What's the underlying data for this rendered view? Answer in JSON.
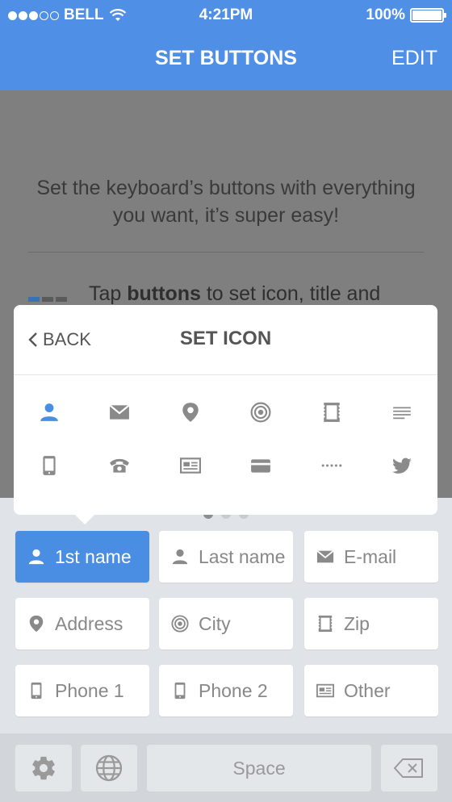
{
  "status": {
    "carrier": "BELL",
    "time": "4:21PM",
    "battery": "100%"
  },
  "nav": {
    "title": "SET BUTTONS",
    "edit": "EDIT"
  },
  "intro": "Set the keyboard’s buttons with everything you want, it’s super easy!",
  "tap": {
    "prefix": "Tap ",
    "bold": "buttons",
    "suffix": " to set icon, title and"
  },
  "popover": {
    "back": "BACK",
    "title": "SET ICON",
    "icons_row1": [
      "person-icon",
      "envelope-icon",
      "location-pin-icon",
      "target-icon",
      "stamp-icon",
      "text-lines-icon"
    ],
    "icons_row2": [
      "mobile-phone-icon",
      "telephone-icon",
      "id-card-icon",
      "credit-card-icon",
      "dots-icon",
      "twitter-icon"
    ]
  },
  "buttons": [
    {
      "label": "1st name",
      "icon": "person-icon",
      "active": true
    },
    {
      "label": "Last name",
      "icon": "person-icon",
      "active": false
    },
    {
      "label": "E-mail",
      "icon": "envelope-icon",
      "active": false
    },
    {
      "label": "Address",
      "icon": "location-pin-icon",
      "active": false
    },
    {
      "label": "City",
      "icon": "target-icon",
      "active": false
    },
    {
      "label": "Zip",
      "icon": "stamp-icon",
      "active": false
    },
    {
      "label": "Phone 1",
      "icon": "mobile-phone-icon",
      "active": false
    },
    {
      "label": "Phone 2",
      "icon": "mobile-phone-icon",
      "active": false
    },
    {
      "label": "Other",
      "icon": "id-card-icon",
      "active": false
    }
  ],
  "keyboard": {
    "space": "Space"
  },
  "colors": {
    "accent": "#4f8fe6",
    "active_key": "#4a8ee4"
  }
}
